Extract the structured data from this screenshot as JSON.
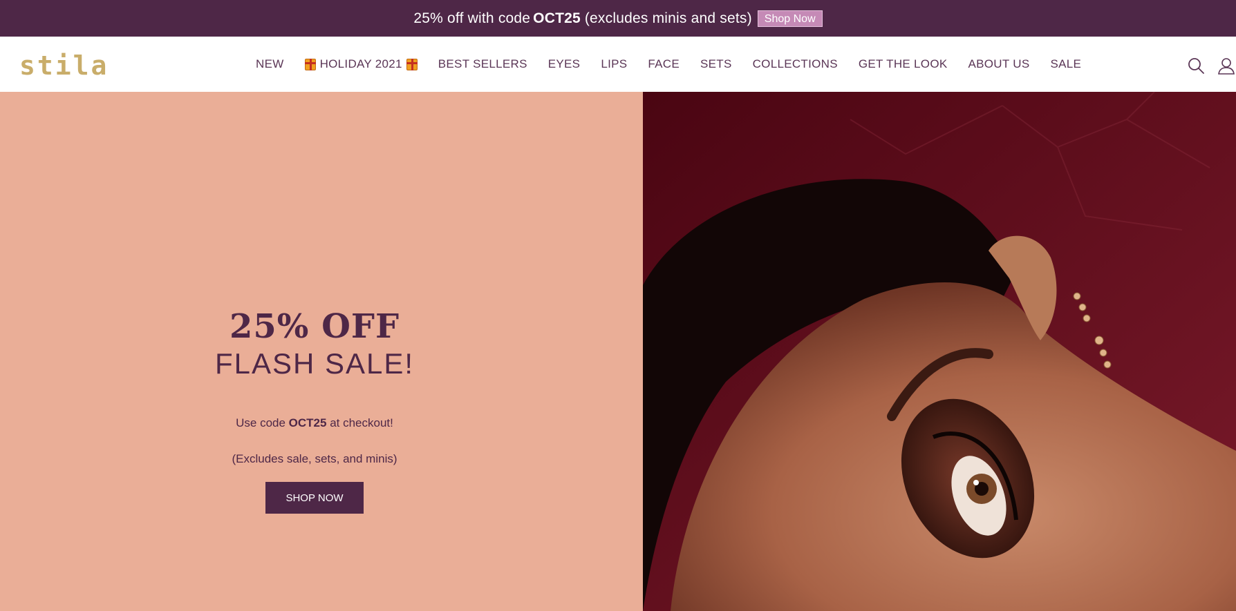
{
  "announcement": {
    "text_pre": "25% off with code",
    "code": "OCT25",
    "text_post": "(excludes minis and sets)",
    "button_label": "Shop Now"
  },
  "header": {
    "logo": "stila",
    "nav": [
      {
        "label": "NEW"
      },
      {
        "label": "HOLIDAY 2021",
        "icon": "gift-icon"
      },
      {
        "label": "BEST SELLERS"
      },
      {
        "label": "EYES"
      },
      {
        "label": "LIPS"
      },
      {
        "label": "FACE"
      },
      {
        "label": "SETS"
      },
      {
        "label": "COLLECTIONS"
      },
      {
        "label": "GET THE LOOK"
      },
      {
        "label": "ABOUT US"
      },
      {
        "label": "SALE"
      }
    ],
    "icons": [
      "search-icon",
      "account-icon"
    ]
  },
  "hero": {
    "title": "25% OFF",
    "subtitle": "FLASH SALE!",
    "code_pre": "Use code",
    "code": "OCT25",
    "code_post": "at checkout!",
    "exclusions": "(Excludes sale, sets, and minis)",
    "button_label": "SHOP NOW"
  },
  "colors": {
    "brand_plum": "#4e2747",
    "hero_peach": "#eaae97",
    "logo_gold": "#c9ad6a",
    "image_bg_burgundy": "#5a0c1e"
  }
}
